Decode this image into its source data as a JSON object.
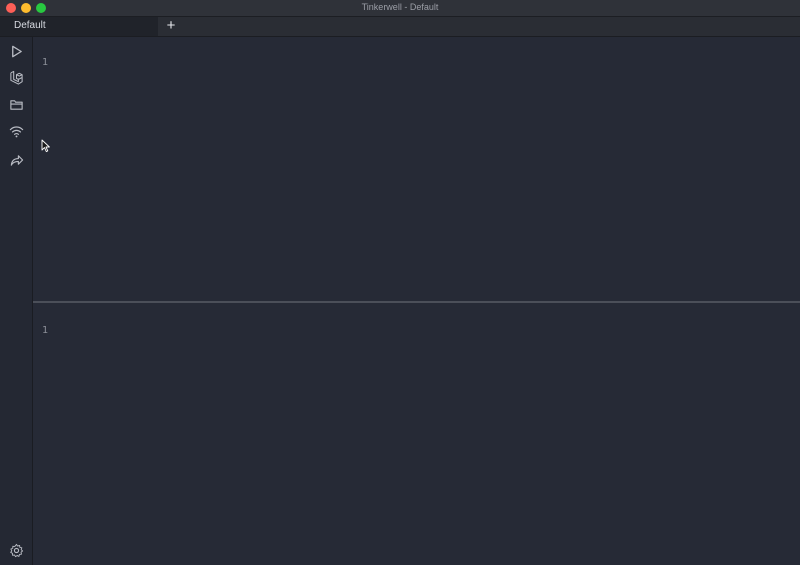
{
  "window": {
    "title": "Tinkerwell - Default",
    "controls": [
      "close",
      "minimize",
      "maximize"
    ]
  },
  "tabs": {
    "items": [
      {
        "label": "Default",
        "active": true
      }
    ],
    "add_label": "+"
  },
  "sidebar": {
    "items": [
      {
        "name": "run-icon"
      },
      {
        "name": "laravel-icon"
      },
      {
        "name": "folder-icon"
      },
      {
        "name": "wifi-icon"
      },
      {
        "name": "share-icon"
      }
    ],
    "footer": {
      "name": "settings-icon"
    }
  },
  "editor": {
    "line_number": "1"
  },
  "output": {
    "line_number": "1"
  },
  "colors": {
    "background": "#262a36",
    "sidebar": "#242833",
    "titlebar": "#2f3239",
    "divider": "#4b4f59",
    "close": "#fe5f57",
    "minimize": "#febc2e",
    "maximize": "#28c840"
  }
}
